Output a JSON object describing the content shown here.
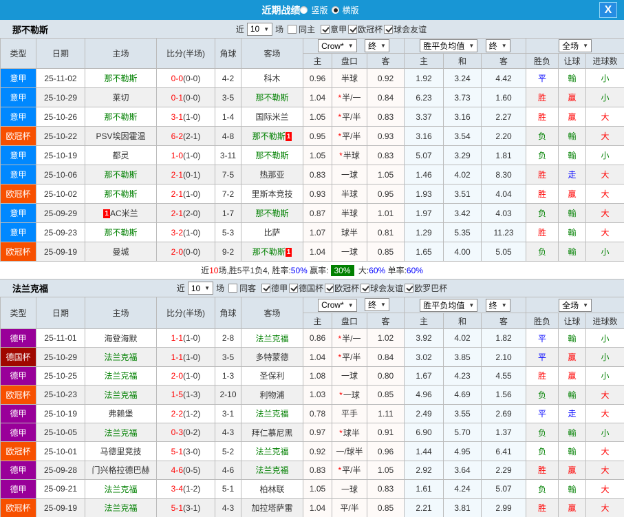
{
  "header": {
    "title": "近期战绩",
    "radio_vertical": "竖版",
    "radio_horizontal": "横版",
    "close": "X"
  },
  "columns": {
    "type": "类型",
    "date": "日期",
    "home": "主场",
    "score": "比分(半场)",
    "corner": "角球",
    "away": "客场",
    "odds_home": "主",
    "handicap": "盘口",
    "odds_away": "客",
    "avg_home": "主",
    "avg_draw": "和",
    "avg_away": "客",
    "result": "胜负",
    "handicap_result": "让球",
    "goals": "进球数",
    "odds_select": "Crow*",
    "final_select": "终",
    "avg_select": "胜平负均值",
    "scope_select": "全场"
  },
  "type_colors": {
    "意甲": "#0088ff",
    "欧冠杯": "#f75000",
    "德甲": "#990099",
    "德国杯": "#a00800"
  },
  "result_colors": {
    "胜": "#ff0000",
    "贏": "#ff0000",
    "大": "#ff0000",
    "负": "#008000",
    "輸": "#008000",
    "小": "#008000",
    "平": "#0000ff",
    "走": "#0000ff"
  },
  "sections": [
    {
      "team": "那不勒斯",
      "filter": {
        "near": "近",
        "count": "10",
        "matches": "场",
        "same": "同主",
        "same_checked": false,
        "leagues": [
          "意甲",
          "欧冠杯",
          "球会友谊"
        ]
      },
      "rows": [
        {
          "type": "意甲",
          "date": "25-11-02",
          "home": "那不勒斯",
          "home_card": "",
          "score": "0-0",
          "half": "(0-0)",
          "corner": "4-2",
          "away": "科木",
          "away_card": "",
          "odds_home": "0.96",
          "handicap": "半球",
          "handicap_star": false,
          "odds_away": "0.92",
          "avg_home": "1.92",
          "avg_draw": "3.24",
          "avg_away": "4.42",
          "result": "平",
          "handicap_result": "輸",
          "goals": "小"
        },
        {
          "type": "意甲",
          "date": "25-10-29",
          "home": "莱切",
          "home_card": "",
          "score": "0-1",
          "half": "(0-0)",
          "corner": "3-5",
          "away": "那不勒斯",
          "away_card": "",
          "odds_home": "1.04",
          "handicap": "半/一",
          "handicap_star": true,
          "odds_away": "0.84",
          "avg_home": "6.23",
          "avg_draw": "3.73",
          "avg_away": "1.60",
          "result": "胜",
          "handicap_result": "贏",
          "goals": "小"
        },
        {
          "type": "意甲",
          "date": "25-10-26",
          "home": "那不勒斯",
          "home_card": "",
          "score": "3-1",
          "half": "(1-0)",
          "corner": "1-4",
          "away": "国际米兰",
          "away_card": "",
          "odds_home": "1.05",
          "handicap": "平/半",
          "handicap_star": true,
          "odds_away": "0.83",
          "avg_home": "3.37",
          "avg_draw": "3.16",
          "avg_away": "2.27",
          "result": "胜",
          "handicap_result": "贏",
          "goals": "大"
        },
        {
          "type": "欧冠杯",
          "date": "25-10-22",
          "home": "PSV埃因霍温",
          "home_card": "",
          "score": "6-2",
          "half": "(2-1)",
          "corner": "4-8",
          "away": "那不勒斯",
          "away_card": "1",
          "odds_home": "0.95",
          "handicap": "平/半",
          "handicap_star": true,
          "odds_away": "0.93",
          "avg_home": "3.16",
          "avg_draw": "3.54",
          "avg_away": "2.20",
          "result": "负",
          "handicap_result": "輸",
          "goals": "大"
        },
        {
          "type": "意甲",
          "date": "25-10-19",
          "home": "都灵",
          "home_card": "",
          "score": "1-0",
          "half": "(1-0)",
          "corner": "3-11",
          "away": "那不勒斯",
          "away_card": "",
          "odds_home": "1.05",
          "handicap": "半球",
          "handicap_star": true,
          "odds_away": "0.83",
          "avg_home": "5.07",
          "avg_draw": "3.29",
          "avg_away": "1.81",
          "result": "负",
          "handicap_result": "輸",
          "goals": "小"
        },
        {
          "type": "意甲",
          "date": "25-10-06",
          "home": "那不勒斯",
          "home_card": "",
          "score": "2-1",
          "half": "(0-1)",
          "corner": "7-5",
          "away": "热那亚",
          "away_card": "",
          "odds_home": "0.83",
          "handicap": "一球",
          "handicap_star": false,
          "odds_away": "1.05",
          "avg_home": "1.46",
          "avg_draw": "4.02",
          "avg_away": "8.30",
          "result": "胜",
          "handicap_result": "走",
          "goals": "大"
        },
        {
          "type": "欧冠杯",
          "date": "25-10-02",
          "home": "那不勒斯",
          "home_card": "",
          "score": "2-1",
          "half": "(1-0)",
          "corner": "7-2",
          "away": "里斯本竞技",
          "away_card": "",
          "odds_home": "0.93",
          "handicap": "半球",
          "handicap_star": false,
          "odds_away": "0.95",
          "avg_home": "1.93",
          "avg_draw": "3.51",
          "avg_away": "4.04",
          "result": "胜",
          "handicap_result": "贏",
          "goals": "大"
        },
        {
          "type": "意甲",
          "date": "25-09-29",
          "home": "AC米兰",
          "home_card": "1",
          "score": "2-1",
          "half": "(2-0)",
          "corner": "1-7",
          "away": "那不勒斯",
          "away_card": "",
          "odds_home": "0.87",
          "handicap": "半球",
          "handicap_star": false,
          "odds_away": "1.01",
          "avg_home": "1.97",
          "avg_draw": "3.42",
          "avg_away": "4.03",
          "result": "负",
          "handicap_result": "輸",
          "goals": "大"
        },
        {
          "type": "意甲",
          "date": "25-09-23",
          "home": "那不勒斯",
          "home_card": "",
          "score": "3-2",
          "half": "(1-0)",
          "corner": "5-3",
          "away": "比萨",
          "away_card": "",
          "odds_home": "1.07",
          "handicap": "球半",
          "handicap_star": false,
          "odds_away": "0.81",
          "avg_home": "1.29",
          "avg_draw": "5.35",
          "avg_away": "11.23",
          "result": "胜",
          "handicap_result": "輸",
          "goals": "大"
        },
        {
          "type": "欧冠杯",
          "date": "25-09-19",
          "home": "曼城",
          "home_card": "",
          "score": "2-0",
          "half": "(0-0)",
          "corner": "9-2",
          "away": "那不勒斯",
          "away_card": "1",
          "odds_home": "1.04",
          "handicap": "一球",
          "handicap_star": false,
          "odds_away": "0.85",
          "avg_home": "1.65",
          "avg_draw": "4.00",
          "avg_away": "5.05",
          "result": "负",
          "handicap_result": "輸",
          "goals": "小"
        }
      ],
      "summary": {
        "near": "近",
        "count": "10",
        "mid": "场,胜5平1负4, 胜率:",
        "win_rate": "50%",
        "label_win": "赢率:",
        "win_badge": "30%",
        "label_big": "大:",
        "big_rate": "60%",
        "label_single": "单率:",
        "single_rate": "60%"
      }
    },
    {
      "team": "法兰克福",
      "filter": {
        "near": "近",
        "count": "10",
        "matches": "场",
        "same": "同客",
        "same_checked": false,
        "leagues": [
          "德甲",
          "德国杯",
          "欧冠杯",
          "球会友谊",
          "欧罗巴杯"
        ]
      },
      "rows": [
        {
          "type": "德甲",
          "date": "25-11-01",
          "home": "海登海默",
          "home_card": "",
          "score": "1-1",
          "half": "(1-0)",
          "corner": "2-8",
          "away": "法兰克福",
          "away_card": "",
          "odds_home": "0.86",
          "handicap": "半/一",
          "handicap_star": true,
          "odds_away": "1.02",
          "avg_home": "3.92",
          "avg_draw": "4.02",
          "avg_away": "1.82",
          "result": "平",
          "handicap_result": "輸",
          "goals": "小"
        },
        {
          "type": "德国杯",
          "date": "25-10-29",
          "home": "法兰克福",
          "home_card": "",
          "score": "1-1",
          "half": "(1-0)",
          "corner": "3-5",
          "away": "多特蒙德",
          "away_card": "",
          "odds_home": "1.04",
          "handicap": "平/半",
          "handicap_star": true,
          "odds_away": "0.84",
          "avg_home": "3.02",
          "avg_draw": "3.85",
          "avg_away": "2.10",
          "result": "平",
          "handicap_result": "贏",
          "goals": "小"
        },
        {
          "type": "德甲",
          "date": "25-10-25",
          "home": "法兰克福",
          "home_card": "",
          "score": "2-0",
          "half": "(1-0)",
          "corner": "1-3",
          "away": "圣保利",
          "away_card": "",
          "odds_home": "1.08",
          "handicap": "一球",
          "handicap_star": false,
          "odds_away": "0.80",
          "avg_home": "1.67",
          "avg_draw": "4.23",
          "avg_away": "4.55",
          "result": "胜",
          "handicap_result": "贏",
          "goals": "小"
        },
        {
          "type": "欧冠杯",
          "date": "25-10-23",
          "home": "法兰克福",
          "home_card": "",
          "score": "1-5",
          "half": "(1-3)",
          "corner": "2-10",
          "away": "利物浦",
          "away_card": "",
          "odds_home": "1.03",
          "handicap": "一球",
          "handicap_star": true,
          "odds_away": "0.85",
          "avg_home": "4.96",
          "avg_draw": "4.69",
          "avg_away": "1.56",
          "result": "负",
          "handicap_result": "輸",
          "goals": "大"
        },
        {
          "type": "德甲",
          "date": "25-10-19",
          "home": "弗赖堡",
          "home_card": "",
          "score": "2-2",
          "half": "(1-2)",
          "corner": "3-1",
          "away": "法兰克福",
          "away_card": "",
          "odds_home": "0.78",
          "handicap": "平手",
          "handicap_star": false,
          "odds_away": "1.11",
          "avg_home": "2.49",
          "avg_draw": "3.55",
          "avg_away": "2.69",
          "result": "平",
          "handicap_result": "走",
          "goals": "大"
        },
        {
          "type": "德甲",
          "date": "25-10-05",
          "home": "法兰克福",
          "home_card": "",
          "score": "0-3",
          "half": "(0-2)",
          "corner": "4-3",
          "away": "拜仁慕尼黑",
          "away_card": "",
          "odds_home": "0.97",
          "handicap": "球半",
          "handicap_star": true,
          "odds_away": "0.91",
          "avg_home": "6.90",
          "avg_draw": "5.70",
          "avg_away": "1.37",
          "result": "负",
          "handicap_result": "輸",
          "goals": "小"
        },
        {
          "type": "欧冠杯",
          "date": "25-10-01",
          "home": "马德里竞技",
          "home_card": "",
          "score": "5-1",
          "half": "(3-0)",
          "corner": "5-2",
          "away": "法兰克福",
          "away_card": "",
          "odds_home": "0.92",
          "handicap": "一/球半",
          "handicap_star": false,
          "odds_away": "0.96",
          "avg_home": "1.44",
          "avg_draw": "4.95",
          "avg_away": "6.41",
          "result": "负",
          "handicap_result": "輸",
          "goals": "大"
        },
        {
          "type": "德甲",
          "date": "25-09-28",
          "home": "门兴格拉德巴赫",
          "home_card": "",
          "score": "4-6",
          "half": "(0-5)",
          "corner": "4-6",
          "away": "法兰克福",
          "away_card": "",
          "odds_home": "0.83",
          "handicap": "平/半",
          "handicap_star": true,
          "odds_away": "1.05",
          "avg_home": "2.92",
          "avg_draw": "3.64",
          "avg_away": "2.29",
          "result": "胜",
          "handicap_result": "贏",
          "goals": "大"
        },
        {
          "type": "德甲",
          "date": "25-09-21",
          "home": "法兰克福",
          "home_card": "",
          "score": "3-4",
          "half": "(1-2)",
          "corner": "5-1",
          "away": "柏林联",
          "away_card": "",
          "odds_home": "1.05",
          "handicap": "一球",
          "handicap_star": false,
          "odds_away": "0.83",
          "avg_home": "1.61",
          "avg_draw": "4.24",
          "avg_away": "5.07",
          "result": "负",
          "handicap_result": "輸",
          "goals": "大"
        },
        {
          "type": "欧冠杯",
          "date": "25-09-19",
          "home": "法兰克福",
          "home_card": "",
          "score": "5-1",
          "half": "(3-1)",
          "corner": "4-3",
          "away": "加拉塔萨雷",
          "away_card": "",
          "odds_home": "1.04",
          "handicap": "平/半",
          "handicap_star": false,
          "odds_away": "0.85",
          "avg_home": "2.21",
          "avg_draw": "3.81",
          "avg_away": "2.99",
          "result": "胜",
          "handicap_result": "贏",
          "goals": "大"
        }
      ],
      "summary": null
    }
  ]
}
